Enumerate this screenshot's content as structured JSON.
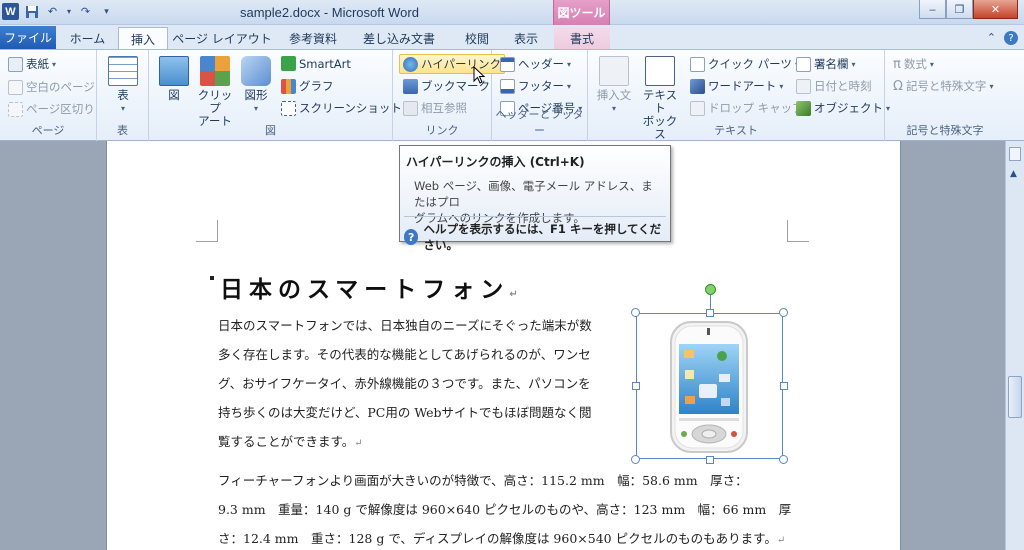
{
  "titlebar": {
    "title": "sample2.docx - Microsoft Word",
    "context_tab": "図ツール",
    "minimize": "‒",
    "restore": "❐",
    "close": "✕"
  },
  "tabs": {
    "file": "ファイル",
    "home": "ホーム",
    "insert": "挿入",
    "page_layout": "ページ レイアウト",
    "references": "参考資料",
    "mailings": "差し込み文書",
    "review": "校閲",
    "view": "表示",
    "format": "書式"
  },
  "ribbon": {
    "pages": {
      "cover": "表紙",
      "blank": "空白のページ",
      "break": "ページ区切り",
      "label": "ページ"
    },
    "tables": {
      "table": "表",
      "label": "表"
    },
    "illustrations": {
      "picture": "図",
      "clipart_1": "クリップ",
      "clipart_2": "アート",
      "shapes": "図形",
      "smartart": "SmartArt",
      "chart": "グラフ",
      "screenshot": "スクリーンショット",
      "label": "図"
    },
    "links": {
      "hyperlink": "ハイパーリンク",
      "bookmark": "ブックマーク",
      "crossref": "相互参照",
      "label": "リンク"
    },
    "header_footer": {
      "header": "ヘッダー",
      "footer": "フッター",
      "page_number": "ページ番号",
      "label": "ヘッダーとフッター"
    },
    "text": {
      "insert_text": "挿入文",
      "textbox_1": "テキスト",
      "textbox_2": "ボックス",
      "quick_parts": "クイック パーツ",
      "wordart": "ワードアート",
      "dropcap": "ドロップ キャップ",
      "signature": "署名欄",
      "datetime": "日付と時刻",
      "object": "オブジェクト",
      "label": "テキスト"
    },
    "symbols": {
      "equation": "数式",
      "symbol": "記号と特殊文字",
      "label": "記号と特殊文字"
    }
  },
  "tooltip": {
    "title": "ハイパーリンクの挿入 (Ctrl+K)",
    "body_1": "Web ページ、画像、電子メール アドレス、またはプロ",
    "body_2": "グラムへのリンクを作成します。",
    "help": "ヘルプを表示するには、F1 キーを押してください。"
  },
  "document": {
    "heading": "日本のスマートフォン",
    "para1": [
      "日本のスマートフォンでは、日本独自のニーズにそぐった端末が数",
      "多く存在します。その代表的な機能としてあげられるのが、ワンセ",
      "グ、おサイフケータイ、赤外線機能の３つです。また、パソコンを",
      "持ち歩くのは大変だけど、PC用の Webサイトでもほぼ問題なく閲",
      "覧することができます。"
    ],
    "para2": [
      "フィーチャーフォンより画面が大きいのが特徴で、高さ：115.2 mm　幅：58.6 mm　厚さ：",
      "9.3 mm　重量：140 g で解像度は 960×640 ピクセルのものや、高さ：123 mm　幅：66 mm　厚",
      "さ：12.4 mm　重さ：128 g で、ディスプレイの解像度は 960×540 ピクセルのものもあります。"
    ],
    "return_mark": "↵"
  }
}
